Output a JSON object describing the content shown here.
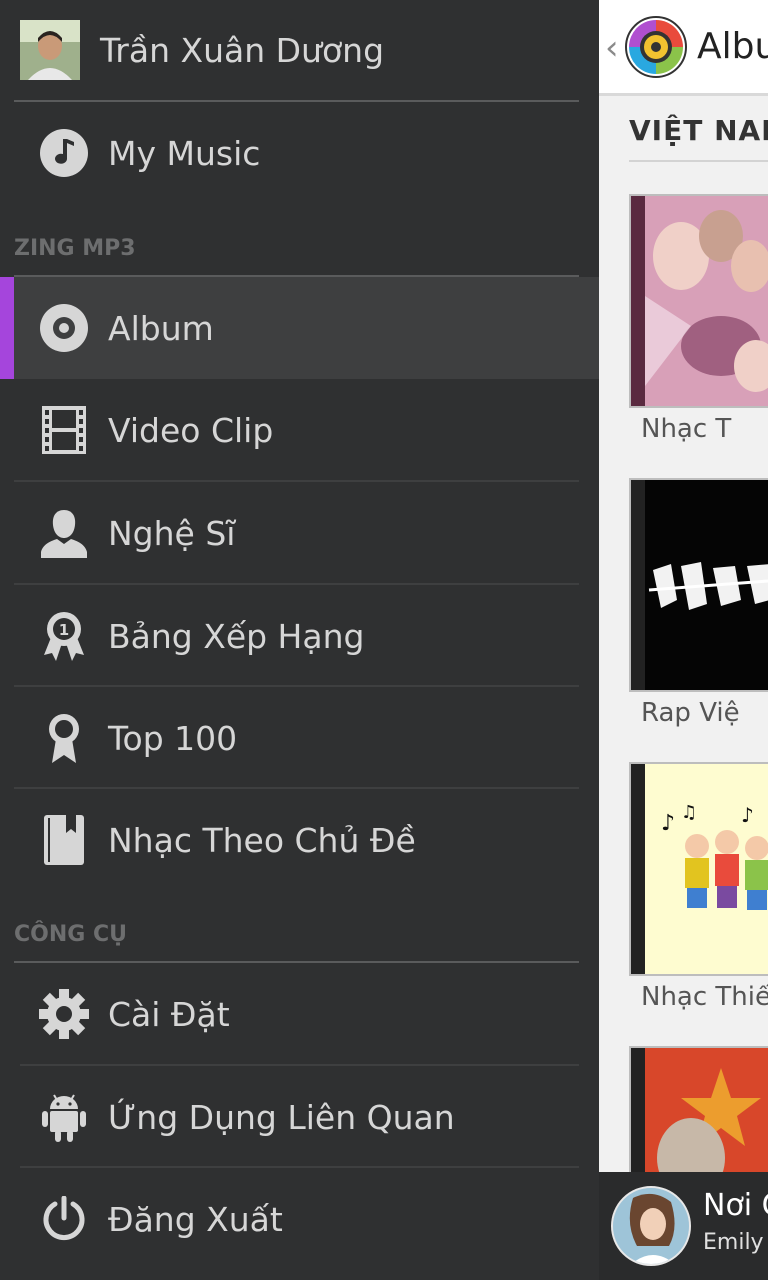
{
  "drawer": {
    "profile": {
      "name": "Trần Xuân Dương"
    },
    "my_music": {
      "label": "My Music",
      "icon": "music-note-icon"
    },
    "sections": [
      {
        "title": "ZING MP3"
      },
      {
        "title": "CÔNG CỤ"
      }
    ],
    "zing_items": [
      {
        "label": "Album",
        "icon": "album-disc-icon",
        "selected": true
      },
      {
        "label": "Video Clip",
        "icon": "film-strip-icon"
      },
      {
        "label": "Nghệ Sĩ",
        "icon": "person-icon"
      },
      {
        "label": "Bảng Xếp Hạng",
        "icon": "ranking-badge-icon"
      },
      {
        "label": "Top 100",
        "icon": "award-icon"
      },
      {
        "label": "Nhạc Theo Chủ Đề",
        "icon": "bookmark-book-icon"
      }
    ],
    "tool_items": [
      {
        "label": "Cài Đặt",
        "icon": "gear-icon"
      },
      {
        "label": "Ứng Dụng Liên Quan",
        "icon": "android-icon"
      },
      {
        "label": "Đăng Xuất",
        "icon": "power-icon"
      }
    ],
    "accent_color": "#a545dc"
  },
  "content": {
    "back_glyph": "‹",
    "title": "Albu",
    "section_title": "VIỆT NAM",
    "albums": [
      {
        "title": "Nhạc T"
      },
      {
        "title": "Rap Việ"
      },
      {
        "title": "Nhạc Thiế"
      },
      {
        "title": ""
      }
    ]
  },
  "player": {
    "song": "Nơi C",
    "artist": "Emily"
  }
}
